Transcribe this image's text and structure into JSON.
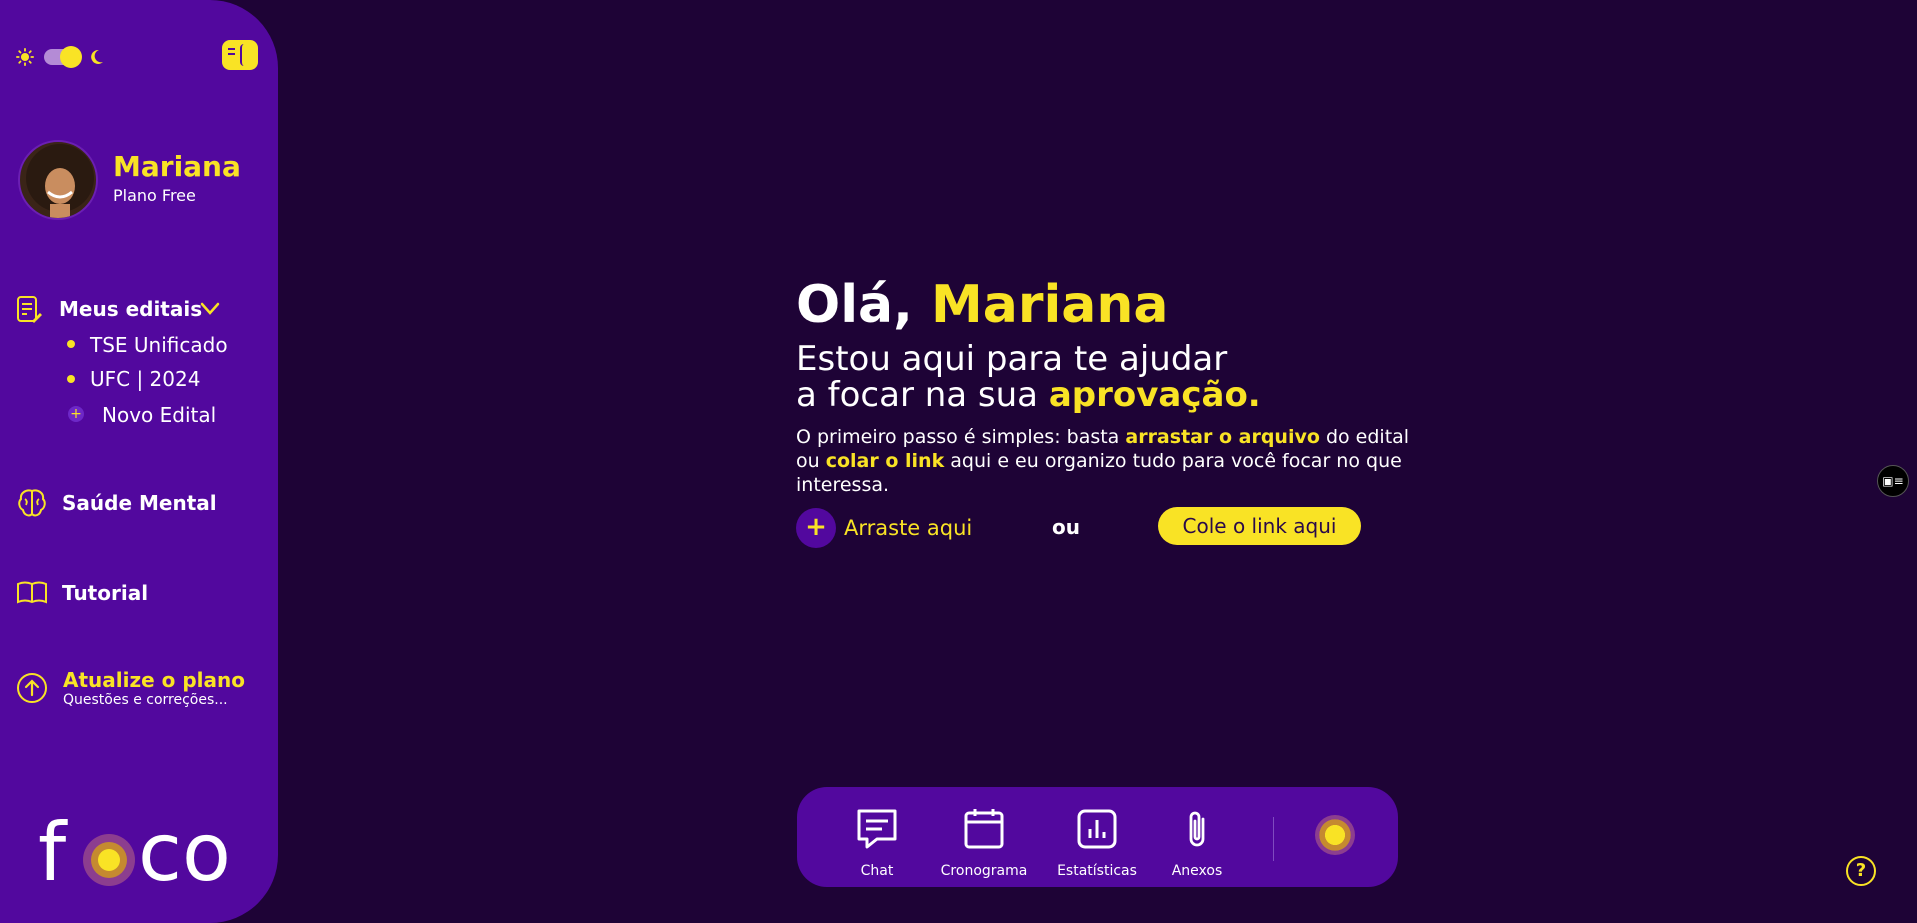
{
  "user": {
    "name": "Mariana",
    "plan": "Plano Free"
  },
  "sidebar": {
    "editais": {
      "label": "Meus editais",
      "items": [
        "TSE Unificado",
        "UFC | 2024"
      ],
      "new_label": "Novo Edital"
    },
    "mental": {
      "label": "Saúde Mental"
    },
    "tutorial": {
      "label": "Tutorial"
    },
    "upgrade": {
      "title": "Atualize o plano",
      "subtitle": "Questões e correções..."
    },
    "logo": {
      "left": "f",
      "right": "co"
    }
  },
  "hero": {
    "greeting": "Olá,",
    "name": "Mariana",
    "line1": "Estou aqui para te ajudar",
    "line2_pre": "a focar na sua ",
    "line2_hl": "aprovação.",
    "desc_1": "O primeiro passo é simples: basta ",
    "desc_hl1": "arrastar o arquivo",
    "desc_2": " do edital ou ",
    "desc_hl2": "colar o link",
    "desc_3": " aqui e eu organizo tudo para você focar no que interessa."
  },
  "upload": {
    "plus": "+",
    "label": "Arraste aqui",
    "or": "ou",
    "paste": "Cole o link aqui"
  },
  "dock": {
    "chat": "Chat",
    "cronograma": "Cronograma",
    "estatisticas": "Estatísticas",
    "anexos": "Anexos"
  },
  "help": {
    "label": "?"
  },
  "colors": {
    "accent": "#f9e325",
    "sidebar": "#52089e",
    "background": "#1e0336"
  }
}
